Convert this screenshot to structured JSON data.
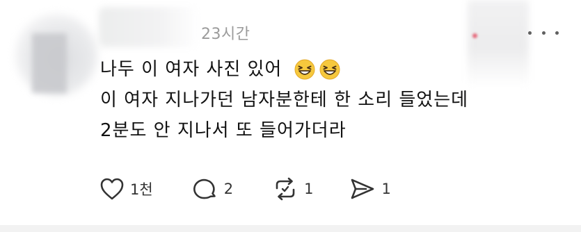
{
  "post": {
    "timestamp": "23시간",
    "lines": [
      "나두 이 여자 사진 있어",
      "이 여자 지나가던 남자분한테 한 소리 들었는데",
      "2분도 안 지나서 또 들어가더라"
    ],
    "emojis": [
      "grinning-squinting-face",
      "grinning-squinting-face"
    ],
    "accent_colors": {
      "emoji_face": "#f6c83d",
      "emoji_outline": "#4a3217",
      "muted_text": "#9b9b9b",
      "icon": "#333333"
    }
  },
  "actions": {
    "like": {
      "icon": "heart-icon",
      "count": "1천"
    },
    "comment": {
      "icon": "comment-icon",
      "count": "2"
    },
    "repost": {
      "icon": "repost-icon",
      "count": "1"
    },
    "share": {
      "icon": "send-icon",
      "count": "1"
    }
  }
}
